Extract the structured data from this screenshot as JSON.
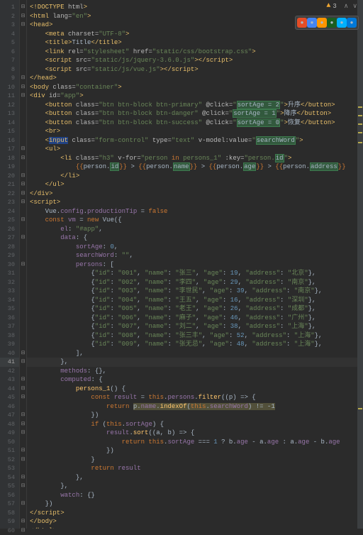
{
  "status": {
    "warning_count": "3",
    "arrows": {
      "up": "∧",
      "down": "∨"
    }
  },
  "browser_icons": [
    "ie",
    "chrome",
    "firefox",
    "opera",
    "safari",
    "edge"
  ],
  "lines": [
    {
      "n": 1,
      "fold": "⊟",
      "html": "<span class='tag'>&lt;!DOCTYPE</span> <span class='attr'>html</span><span class='tag'>&gt;</span>"
    },
    {
      "n": 2,
      "fold": "⊟",
      "html": "<span class='tag'>&lt;html </span><span class='attr'>lang=</span><span class='str'>\"en\"</span><span class='tag'>&gt;</span>"
    },
    {
      "n": 3,
      "fold": "⊟",
      "html": "<span class='tag'>&lt;head&gt;</span>"
    },
    {
      "n": 4,
      "fold": "",
      "html": "    <span class='tag'>&lt;meta </span><span class='attr'>charset=</span><span class='str'>\"UTF-8\"</span><span class='tag'>&gt;</span>"
    },
    {
      "n": 5,
      "fold": "",
      "html": "    <span class='tag'>&lt;title&gt;</span><span class='txt'>Title</span><span class='tag'>&lt;/title&gt;</span>"
    },
    {
      "n": 6,
      "fold": "",
      "html": "    <span class='tag'>&lt;link </span><span class='attr'>rel=</span><span class='str'>\"stylesheet\"</span> <span class='attr'>href=</span><span class='str'>\"static/css/bootstrap.css\"</span><span class='tag'>&gt;</span>"
    },
    {
      "n": 7,
      "fold": "",
      "html": "    <span class='tag'>&lt;script </span><span class='attr'>src=</span><span class='str'>\"static/js/jquery-3.6.0.js\"</span><span class='tag'>&gt;&lt;/script&gt;</span>"
    },
    {
      "n": 8,
      "fold": "",
      "html": "    <span class='tag'>&lt;script </span><span class='attr'>src=</span><span class='str'>\"static/js/vue.js\"</span><span class='tag'>&gt;&lt;/script&gt;</span>"
    },
    {
      "n": 9,
      "fold": "⊟",
      "html": "<span class='tag'>&lt;/head&gt;</span>"
    },
    {
      "n": 10,
      "fold": "⊟",
      "html": "<span class='tag'>&lt;body </span><span class='attr'>class=</span><span class='str'>\"container\"</span><span class='tag'>&gt;</span>"
    },
    {
      "n": 11,
      "fold": "⊟",
      "html": "<span class='tag'>&lt;div </span><span class='attr'>id=</span><span class='str'>\"app\"</span><span class='tag'>&gt;</span>"
    },
    {
      "n": 12,
      "fold": "",
      "html": "    <span class='tag'>&lt;button </span><span class='attr'>class=</span><span class='str'>\"btn btn-block btn-primary\"</span> <span class='attr'>@click=</span><span class='str'>\"</span><span class='hl-occ'>sortAge = 2</span><span class='str'>\"</span><span class='tag'>&gt;</span><span class='txt'>升序</span><span class='tag'>&lt;/button&gt;</span>"
    },
    {
      "n": 13,
      "fold": "",
      "html": "    <span class='tag'>&lt;button </span><span class='attr'>class=</span><span class='str'>\"btn btn-block btn-danger\"</span> <span class='attr'>@click=</span><span class='str'>\"</span><span class='hl-occ'>sortAge = 1</span><span class='str'>\"</span><span class='tag'>&gt;</span><span class='txt'>降序</span><span class='tag'>&lt;/button&gt;</span>"
    },
    {
      "n": 14,
      "fold": "",
      "html": "    <span class='tag'>&lt;button </span><span class='attr'>class=</span><span class='str'>\"btn btn-block btn-success\"</span> <span class='attr'>@click=</span><span class='str'>\"</span><span class='hl-occ'>sortAge = 0</span><span class='str'>\"</span><span class='tag'>&gt;</span><span class='txt'>恢复</span><span class='tag'>&lt;/button&gt;</span>"
    },
    {
      "n": 15,
      "fold": "",
      "html": "    <span class='tag'>&lt;br&gt;</span>"
    },
    {
      "n": 16,
      "fold": "",
      "html": "    <span class='tag'>&lt;</span><span class='hl-sel tag'>input</span><span class='tag'> </span><span class='attr'>class=</span><span class='str'>\"form-control\"</span> <span class='attr'>type=</span><span class='str'>\"text\"</span> <span class='attr'>v-model:value=</span><span class='str'>\"</span><span class='hl-occ'>searchWord</span><span class='str'>\"</span><span class='tag'>&gt;</span>"
    },
    {
      "n": 17,
      "fold": "⊟",
      "html": "    <span class='tag'>&lt;ul&gt;</span>"
    },
    {
      "n": 18,
      "fold": "⊟",
      "html": "        <span class='tag'>&lt;li </span><span class='attr'>class=</span><span class='str'>\"h3\"</span> <span class='attr'>v-for=</span><span class='str'>\"person </span><span class='kw'>in</span><span class='str'> persons_1\"</span> <span class='attr'>:key=</span><span class='str'>\"person.</span><span class='hl-occ'>id</span><span class='str'>\"</span><span class='tag'>&gt;</span>"
    },
    {
      "n": 19,
      "fold": "",
      "html": "            <span class='interp'>{{</span><span class='interp-inner'>person.</span><span class='hl-occ'>id</span><span class='interp'>}}</span><span class='txt'> &gt; </span><span class='interp'>{{</span><span class='interp-inner'>person.</span><span class='hl-occ'>name</span><span class='interp'>}}</span><span class='txt'> &gt; </span><span class='interp'>{{</span><span class='interp-inner'>person.</span><span class='hl-occ'>age</span><span class='interp'>}}</span><span class='txt'> &gt; </span><span class='interp'>{{</span><span class='interp-inner'>person.</span><span class='hl-occ'>address</span><span class='interp'>}}</span>"
    },
    {
      "n": 20,
      "fold": "⊟",
      "html": "        <span class='tag'>&lt;/li&gt;</span>"
    },
    {
      "n": 21,
      "fold": "⊟",
      "html": "    <span class='tag'>&lt;/ul&gt;</span>"
    },
    {
      "n": 22,
      "fold": "⊟",
      "html": "<span class='tag'>&lt;/div&gt;</span>"
    },
    {
      "n": 23,
      "fold": "⊟",
      "html": "<span class='tag'>&lt;script&gt;</span>"
    },
    {
      "n": 24,
      "fold": "",
      "html": "    <span class='plain'>Vue.</span><span class='prop'>config</span><span class='plain'>.</span><span class='prop'>productionTip</span><span class='plain'> = </span><span class='kw'>false</span>"
    },
    {
      "n": 25,
      "fold": "⊟",
      "html": "    <span class='kw'>const </span><span class='prop'>vm</span><span class='plain'> = </span><span class='kw'>new </span><span class='plain'>Vue({</span>"
    },
    {
      "n": 26,
      "fold": "",
      "html": "        <span class='prop'>el</span><span class='plain'>: </span><span class='str'>\"#app\"</span><span class='plain'>,</span>"
    },
    {
      "n": 27,
      "fold": "⊟",
      "html": "        <span class='prop'>data</span><span class='plain'>: {</span>"
    },
    {
      "n": 28,
      "fold": "",
      "html": "            <span class='prop'>sortAge</span><span class='plain'>: </span><span class='num'>0</span><span class='plain'>,</span>"
    },
    {
      "n": 29,
      "fold": "",
      "html": "            <span class='prop'>searchWord</span><span class='plain'>: </span><span class='str'>\"\"</span><span class='plain'>,</span>"
    },
    {
      "n": 30,
      "fold": "⊟",
      "html": "            <span class='prop'>persons</span><span class='plain'>: [</span>"
    },
    {
      "n": 31,
      "fold": "",
      "html": "                <span class='plain'>{</span><span class='str'>\"id\"</span><span class='plain'>: </span><span class='str'>\"001\"</span><span class='plain'>, </span><span class='str'>\"name\"</span><span class='plain'>: </span><span class='str'>\"张三\"</span><span class='plain'>, </span><span class='str'>\"age\"</span><span class='plain'>: </span><span class='num'>19</span><span class='plain'>, </span><span class='str'>\"address\"</span><span class='plain'>: </span><span class='str'>\"北京\"</span><span class='plain'>},</span>"
    },
    {
      "n": 32,
      "fold": "",
      "html": "                <span class='plain'>{</span><span class='str'>\"id\"</span><span class='plain'>: </span><span class='str'>\"002\"</span><span class='plain'>, </span><span class='str'>\"name\"</span><span class='plain'>: </span><span class='str'>\"李四\"</span><span class='plain'>, </span><span class='str'>\"age\"</span><span class='plain'>: </span><span class='num'>29</span><span class='plain'>, </span><span class='str'>\"address\"</span><span class='plain'>: </span><span class='str'>\"南京\"</span><span class='plain'>},</span>"
    },
    {
      "n": 33,
      "fold": "",
      "html": "                <span class='plain'>{</span><span class='str'>\"id\"</span><span class='plain'>: </span><span class='str'>\"003\"</span><span class='plain'>, </span><span class='str'>\"name\"</span><span class='plain'>: </span><span class='str'>\"李世民\"</span><span class='plain'>, </span><span class='str'>\"age\"</span><span class='plain'>: </span><span class='num'>39</span><span class='plain'>, </span><span class='str'>\"address\"</span><span class='plain'>: </span><span class='str'>\"南京\"</span><span class='plain'>},</span>"
    },
    {
      "n": 34,
      "fold": "",
      "html": "                <span class='plain'>{</span><span class='str'>\"id\"</span><span class='plain'>: </span><span class='str'>\"004\"</span><span class='plain'>, </span><span class='str'>\"name\"</span><span class='plain'>: </span><span class='str'>\"王五\"</span><span class='plain'>, </span><span class='str'>\"age\"</span><span class='plain'>: </span><span class='num'>16</span><span class='plain'>, </span><span class='str'>\"address\"</span><span class='plain'>: </span><span class='str'>\"深圳\"</span><span class='plain'>},</span>"
    },
    {
      "n": 35,
      "fold": "",
      "html": "                <span class='plain'>{</span><span class='str'>\"id\"</span><span class='plain'>: </span><span class='str'>\"005\"</span><span class='plain'>, </span><span class='str'>\"name\"</span><span class='plain'>: </span><span class='str'>\"老王\"</span><span class='plain'>, </span><span class='str'>\"age\"</span><span class='plain'>: </span><span class='num'>26</span><span class='plain'>, </span><span class='str'>\"address\"</span><span class='plain'>: </span><span class='str'>\"成都\"</span><span class='plain'>},</span>"
    },
    {
      "n": 36,
      "fold": "",
      "html": "                <span class='plain'>{</span><span class='str'>\"id\"</span><span class='plain'>: </span><span class='str'>\"006\"</span><span class='plain'>, </span><span class='str'>\"name\"</span><span class='plain'>: </span><span class='str'>\"麻子\"</span><span class='plain'>, </span><span class='str'>\"age\"</span><span class='plain'>: </span><span class='num'>46</span><span class='plain'>, </span><span class='str'>\"address\"</span><span class='plain'>: </span><span class='str'>\"广州\"</span><span class='plain'>},</span>"
    },
    {
      "n": 37,
      "fold": "",
      "html": "                <span class='plain'>{</span><span class='str'>\"id\"</span><span class='plain'>: </span><span class='str'>\"007\"</span><span class='plain'>, </span><span class='str'>\"name\"</span><span class='plain'>: </span><span class='str'>\"刘二\"</span><span class='plain'>, </span><span class='str'>\"age\"</span><span class='plain'>: </span><span class='num'>38</span><span class='plain'>, </span><span class='str'>\"address\"</span><span class='plain'>: </span><span class='str'>\"上海\"</span><span class='plain'>},</span>"
    },
    {
      "n": 38,
      "fold": "",
      "html": "                <span class='plain'>{</span><span class='str'>\"id\"</span><span class='plain'>: </span><span class='str'>\"008\"</span><span class='plain'>, </span><span class='str'>\"name\"</span><span class='plain'>: </span><span class='str'>\"张三丰\"</span><span class='plain'>, </span><span class='str'>\"age\"</span><span class='plain'>: </span><span class='num'>52</span><span class='plain'>, </span><span class='str'>\"address\"</span><span class='plain'>: </span><span class='str'>\"上海\"</span><span class='plain'>},</span>"
    },
    {
      "n": 39,
      "fold": "",
      "html": "                <span class='plain'>{</span><span class='str'>\"id\"</span><span class='plain'>: </span><span class='str'>\"009\"</span><span class='plain'>, </span><span class='str'>\"name\"</span><span class='plain'>: </span><span class='str'>\"张无忌\"</span><span class='plain'>, </span><span class='str'>\"age\"</span><span class='plain'>: </span><span class='num'>48</span><span class='plain'>, </span><span class='str'>\"address\"</span><span class='plain'>: </span><span class='str'>\"上海\"</span><span class='plain'>},</span>"
    },
    {
      "n": 40,
      "fold": "⊟",
      "html": "            <span class='plain'>],</span>"
    },
    {
      "n": 41,
      "fold": "⊟",
      "html": "        <span class='plain'>},</span>",
      "active": true
    },
    {
      "n": 42,
      "fold": "",
      "html": "        <span class='prop'>methods</span><span class='plain'>: {},</span>"
    },
    {
      "n": 43,
      "fold": "⊟",
      "html": "        <span class='prop'>computed</span><span class='plain'>: {</span>"
    },
    {
      "n": 44,
      "fold": "⊟",
      "html": "            <span class='fn'>persons_1</span><span class='plain'>() {</span>"
    },
    {
      "n": 45,
      "fold": "⊟",
      "html": "                <span class='kw'>const </span><span class='prop'>result</span><span class='plain'> = </span><span class='kw'>this</span><span class='plain'>.</span><span class='prop'>persons</span><span class='plain'>.</span><span class='fn'>filter</span><span class='plain'>((p) =&gt; {</span>"
    },
    {
      "n": 46,
      "fold": "",
      "html": "                    <span class='kw'>return </span><span class='hl-warn'>p.<span class='prop'>name</span>.<span class='fn'>indexOf</span>(<span class='kw'>this</span>.<span class='prop'>searchWord</span>) != -1</span>"
    },
    {
      "n": 47,
      "fold": "⊟",
      "html": "                <span class='plain'>})</span>"
    },
    {
      "n": 48,
      "fold": "⊟",
      "html": "                <span class='kw'>if </span><span class='plain'>(</span><span class='kw'>this</span><span class='plain'>.</span><span class='prop'>sortAge</span><span class='plain'>) {</span>"
    },
    {
      "n": 49,
      "fold": "⊟",
      "html": "                    <span class='prop'>result</span><span class='plain'>.</span><span class='fn'>sort</span><span class='plain'>((a, b) =&gt; {</span>"
    },
    {
      "n": 50,
      "fold": "",
      "html": "                        <span class='kw'>return this</span><span class='plain'>.</span><span class='prop'>sortAge</span><span class='plain'> === </span><span class='num'>1</span><span class='plain'> ? b.</span><span class='prop'>age</span><span class='plain'> - a.</span><span class='prop'>age</span><span class='plain'> : a.</span><span class='prop'>age</span><span class='plain'> - b.</span><span class='prop'>age</span>"
    },
    {
      "n": 51,
      "fold": "⊟",
      "html": "                    <span class='plain'>})</span>"
    },
    {
      "n": 52,
      "fold": "⊟",
      "html": "                <span class='plain'>}</span>"
    },
    {
      "n": 53,
      "fold": "",
      "html": "                <span class='kw'>return </span><span class='prop'>result</span>"
    },
    {
      "n": 54,
      "fold": "⊟",
      "html": "            <span class='plain'>},</span>"
    },
    {
      "n": 55,
      "fold": "⊟",
      "html": "        <span class='plain'>},</span>"
    },
    {
      "n": 56,
      "fold": "",
      "html": "        <span class='prop'>watch</span><span class='plain'>: {}</span>"
    },
    {
      "n": 57,
      "fold": "⊟",
      "html": "    <span class='plain'>})</span>"
    },
    {
      "n": 58,
      "fold": "",
      "html": "<span class='tag'>&lt;/script&gt;</span>"
    },
    {
      "n": 59,
      "fold": "⊟",
      "html": "<span class='tag'>&lt;/body&gt;</span>"
    },
    {
      "n": 60,
      "fold": "⊟",
      "html": "<span class='tag'>&lt;/html&gt;</span>"
    }
  ],
  "scrollbar_marks": [
    150,
    162,
    174,
    186,
    200,
    575
  ]
}
